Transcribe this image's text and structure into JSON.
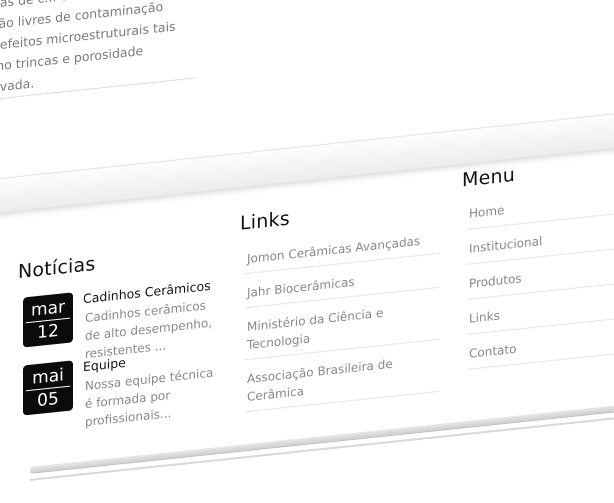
{
  "intro": {
    "lines": [
      "nas de c... contaminação",
      "são livres de contaminação",
      "defeitos microestruturais tais",
      "mo trincas e porosidade",
      "evada."
    ]
  },
  "news": {
    "title": "Notícias",
    "items": [
      {
        "month": "mar",
        "day": "12",
        "heading": "Cadinhos Cerâmicos",
        "text": "Cadinhos cerâmicos de alto desempenho, resistentes ..."
      },
      {
        "month": "mai",
        "day": "05",
        "heading": "Equipe",
        "text": "Nossa equipe técnica é formada por profissionais..."
      }
    ]
  },
  "links": {
    "title": "Links",
    "items": [
      "Jomon Cerâmicas Avançadas",
      "Jahr Biocerâmicas",
      "Ministério da Ciência e Tecnologia",
      "Associação Brasileira de Cerâmica"
    ]
  },
  "menu": {
    "title": "Menu",
    "items": [
      "Home",
      "Institucional",
      "Produtos",
      "Links",
      "Contato"
    ]
  }
}
